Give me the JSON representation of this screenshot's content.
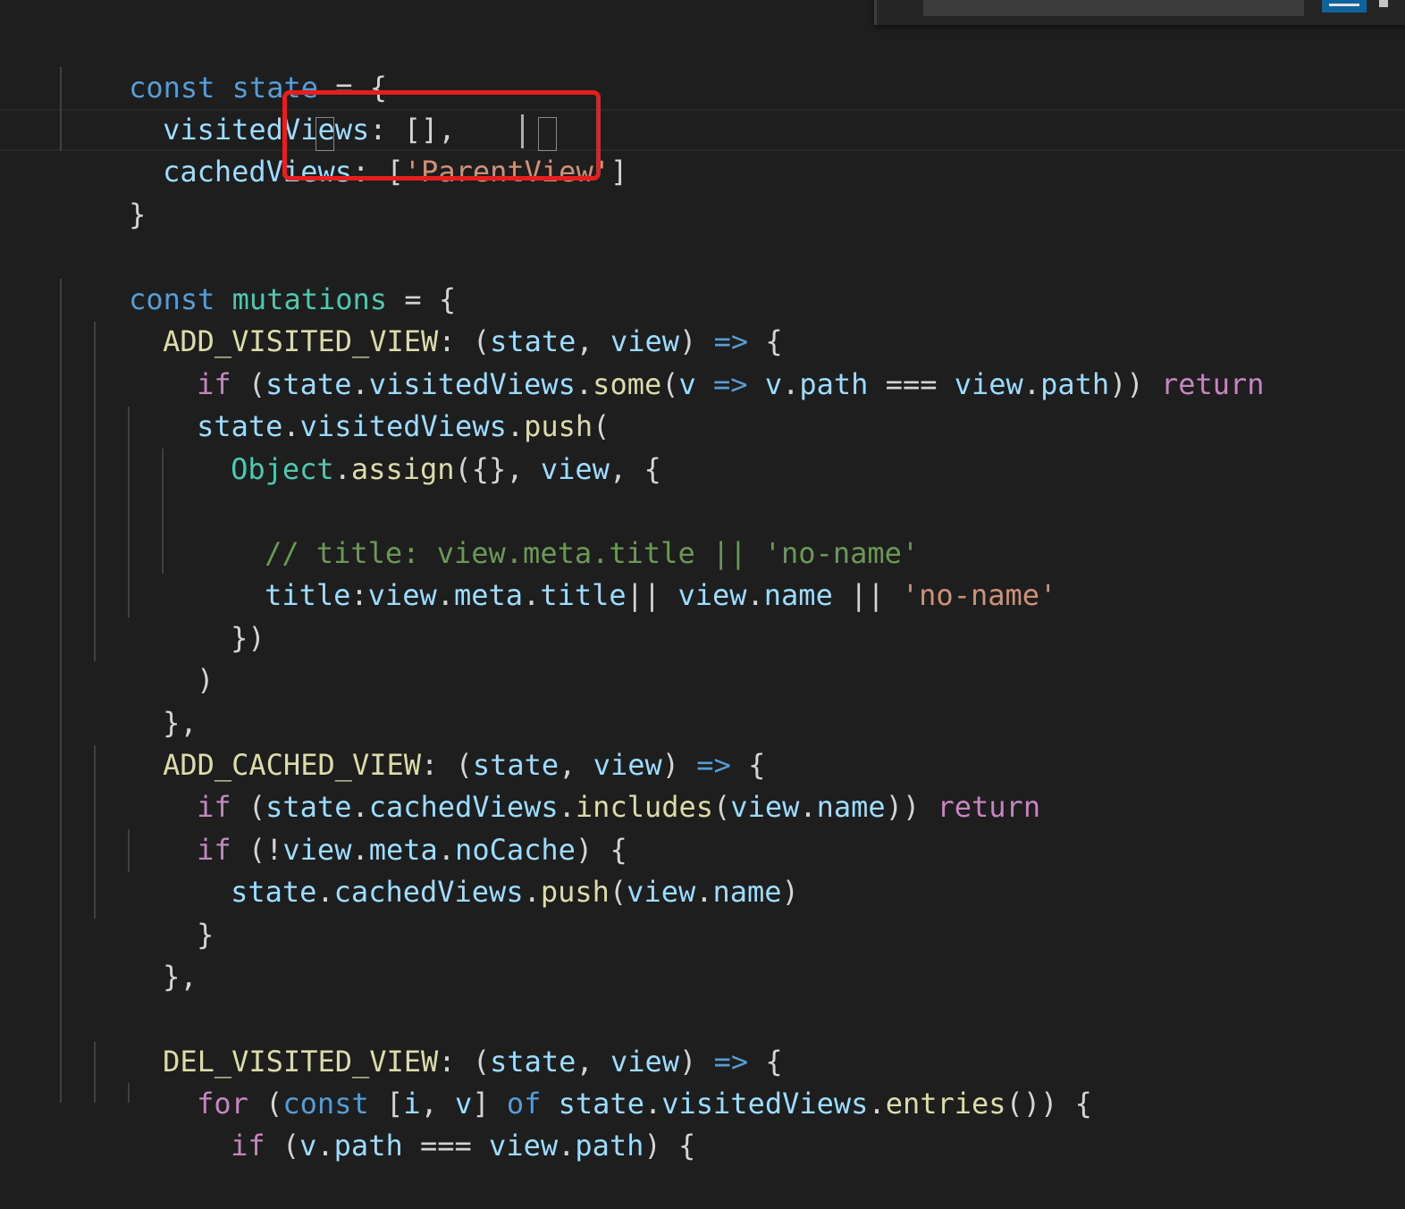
{
  "editor": {
    "language": "javascript",
    "theme_colors": {
      "background": "#1e1e1e",
      "keyword": "#569cd6",
      "control_keyword": "#c586c0",
      "variable": "#9cdcfe",
      "function": "#dcdcaa",
      "string": "#ce9178",
      "class": "#4ec9b0",
      "comment": "#6a9955",
      "annotation_box": "#e61e1e"
    },
    "lines": [
      [
        "const",
        " ",
        "state",
        " = {"
      ],
      [
        "visitedViews",
        ": [],"
      ],
      [
        "cachedViews",
        ": ",
        "[",
        "'ParentView'",
        "]"
      ],
      [
        "}"
      ],
      [
        "const",
        " ",
        "mutations",
        " = {"
      ],
      [
        "ADD_VISITED_VIEW",
        ": (",
        "state",
        ", ",
        "view",
        ") ",
        "=>",
        " {"
      ],
      [
        "if",
        " (",
        "state",
        ".",
        "visitedViews",
        ".",
        "some",
        "(",
        "v",
        " ",
        "=>",
        " ",
        "v",
        ".",
        "path",
        " === ",
        "view",
        ".",
        "path",
        ")) ",
        "return"
      ],
      [
        "state",
        ".",
        "visitedViews",
        ".",
        "push",
        "("
      ],
      [
        "Object",
        ".",
        "assign",
        "({}, ",
        "view",
        ", {"
      ],
      [
        "// title: view.meta.title || 'no-name'"
      ],
      [
        "title",
        ":",
        "view",
        ".",
        "meta",
        ".",
        "title",
        "|| ",
        "view",
        ".",
        "name",
        " || ",
        "'no-name'"
      ],
      [
        "})"
      ],
      [
        ")"
      ],
      [
        "},"
      ],
      [
        "ADD_CACHED_VIEW",
        ": (",
        "state",
        ", ",
        "view",
        ") ",
        "=>",
        " {"
      ],
      [
        "if",
        " (",
        "state",
        ".",
        "cachedViews",
        ".",
        "includes",
        "(",
        "view",
        ".",
        "name",
        ")) ",
        "return"
      ],
      [
        "if",
        " (!",
        "view",
        ".",
        "meta",
        ".",
        "noCache",
        ") {"
      ],
      [
        "state",
        ".",
        "cachedViews",
        ".",
        "push",
        "(",
        "view",
        ".",
        "name",
        ")"
      ],
      [
        "}"
      ],
      [
        "},"
      ],
      [
        "DEL_VISITED_VIEW",
        ": (",
        "state",
        ", ",
        "view",
        ") ",
        "=>",
        " {"
      ],
      [
        "for",
        " (",
        "const",
        " [",
        "i",
        ", ",
        "v",
        "] ",
        "of",
        " ",
        "state",
        ".",
        "visitedViews",
        ".",
        "entries",
        "()) {"
      ],
      [
        "if",
        " (",
        "v",
        ".",
        "path",
        " === ",
        "view",
        ".",
        "path",
        ") {"
      ]
    ]
  },
  "find_widget": {
    "icons": [
      "search-input",
      "regex-toggle-icon",
      "close-icon"
    ]
  }
}
